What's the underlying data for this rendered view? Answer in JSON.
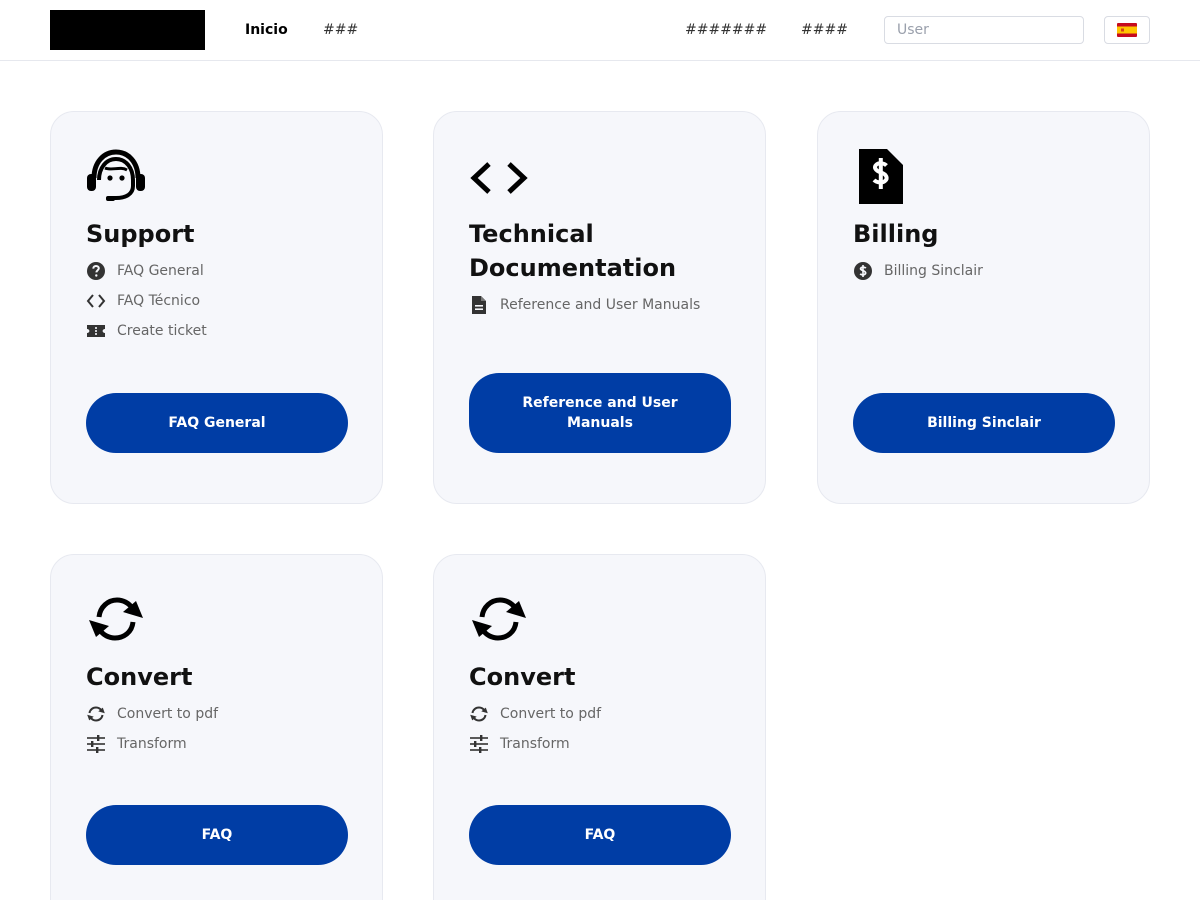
{
  "header": {
    "nav": [
      {
        "label": "Inicio",
        "active": true
      },
      {
        "label": "###"
      },
      {
        "label": "#######"
      },
      {
        "label": "####"
      }
    ],
    "search": {
      "placeholder": "User"
    },
    "language": {
      "flag": "es-flag-icon"
    }
  },
  "cards": [
    {
      "icon": "headset-agent-icon",
      "title": "Support",
      "links": [
        {
          "icon": "question-circle-icon",
          "label": "FAQ General"
        },
        {
          "icon": "code-icon",
          "label": "FAQ Técnico"
        },
        {
          "icon": "ticket-icon",
          "label": "Create ticket"
        }
      ],
      "button": "FAQ General"
    },
    {
      "icon": "code-icon",
      "title": "Technical Documentation",
      "links": [
        {
          "icon": "document-icon",
          "label": "Reference and User Manuals"
        }
      ],
      "button": "Reference and User Manuals"
    },
    {
      "icon": "invoice-dollar-icon",
      "title": "Billing",
      "links": [
        {
          "icon": "dollar-circle-icon",
          "label": "Billing Sinclair"
        }
      ],
      "button": "Billing Sinclair"
    },
    {
      "icon": "sync-icon",
      "title": "Convert",
      "links": [
        {
          "icon": "sync-icon",
          "label": "Convert to pdf"
        },
        {
          "icon": "sliders-icon",
          "label": "Transform"
        }
      ],
      "button": "FAQ"
    },
    {
      "icon": "sync-icon",
      "title": "Convert",
      "links": [
        {
          "icon": "sync-icon",
          "label": "Convert to pdf"
        },
        {
          "icon": "sliders-icon",
          "label": "Transform"
        }
      ],
      "button": "FAQ"
    }
  ],
  "colors": {
    "primary_button": "#003da5",
    "card_background": "#f6f7fb",
    "card_border": "#e7e9f0"
  }
}
